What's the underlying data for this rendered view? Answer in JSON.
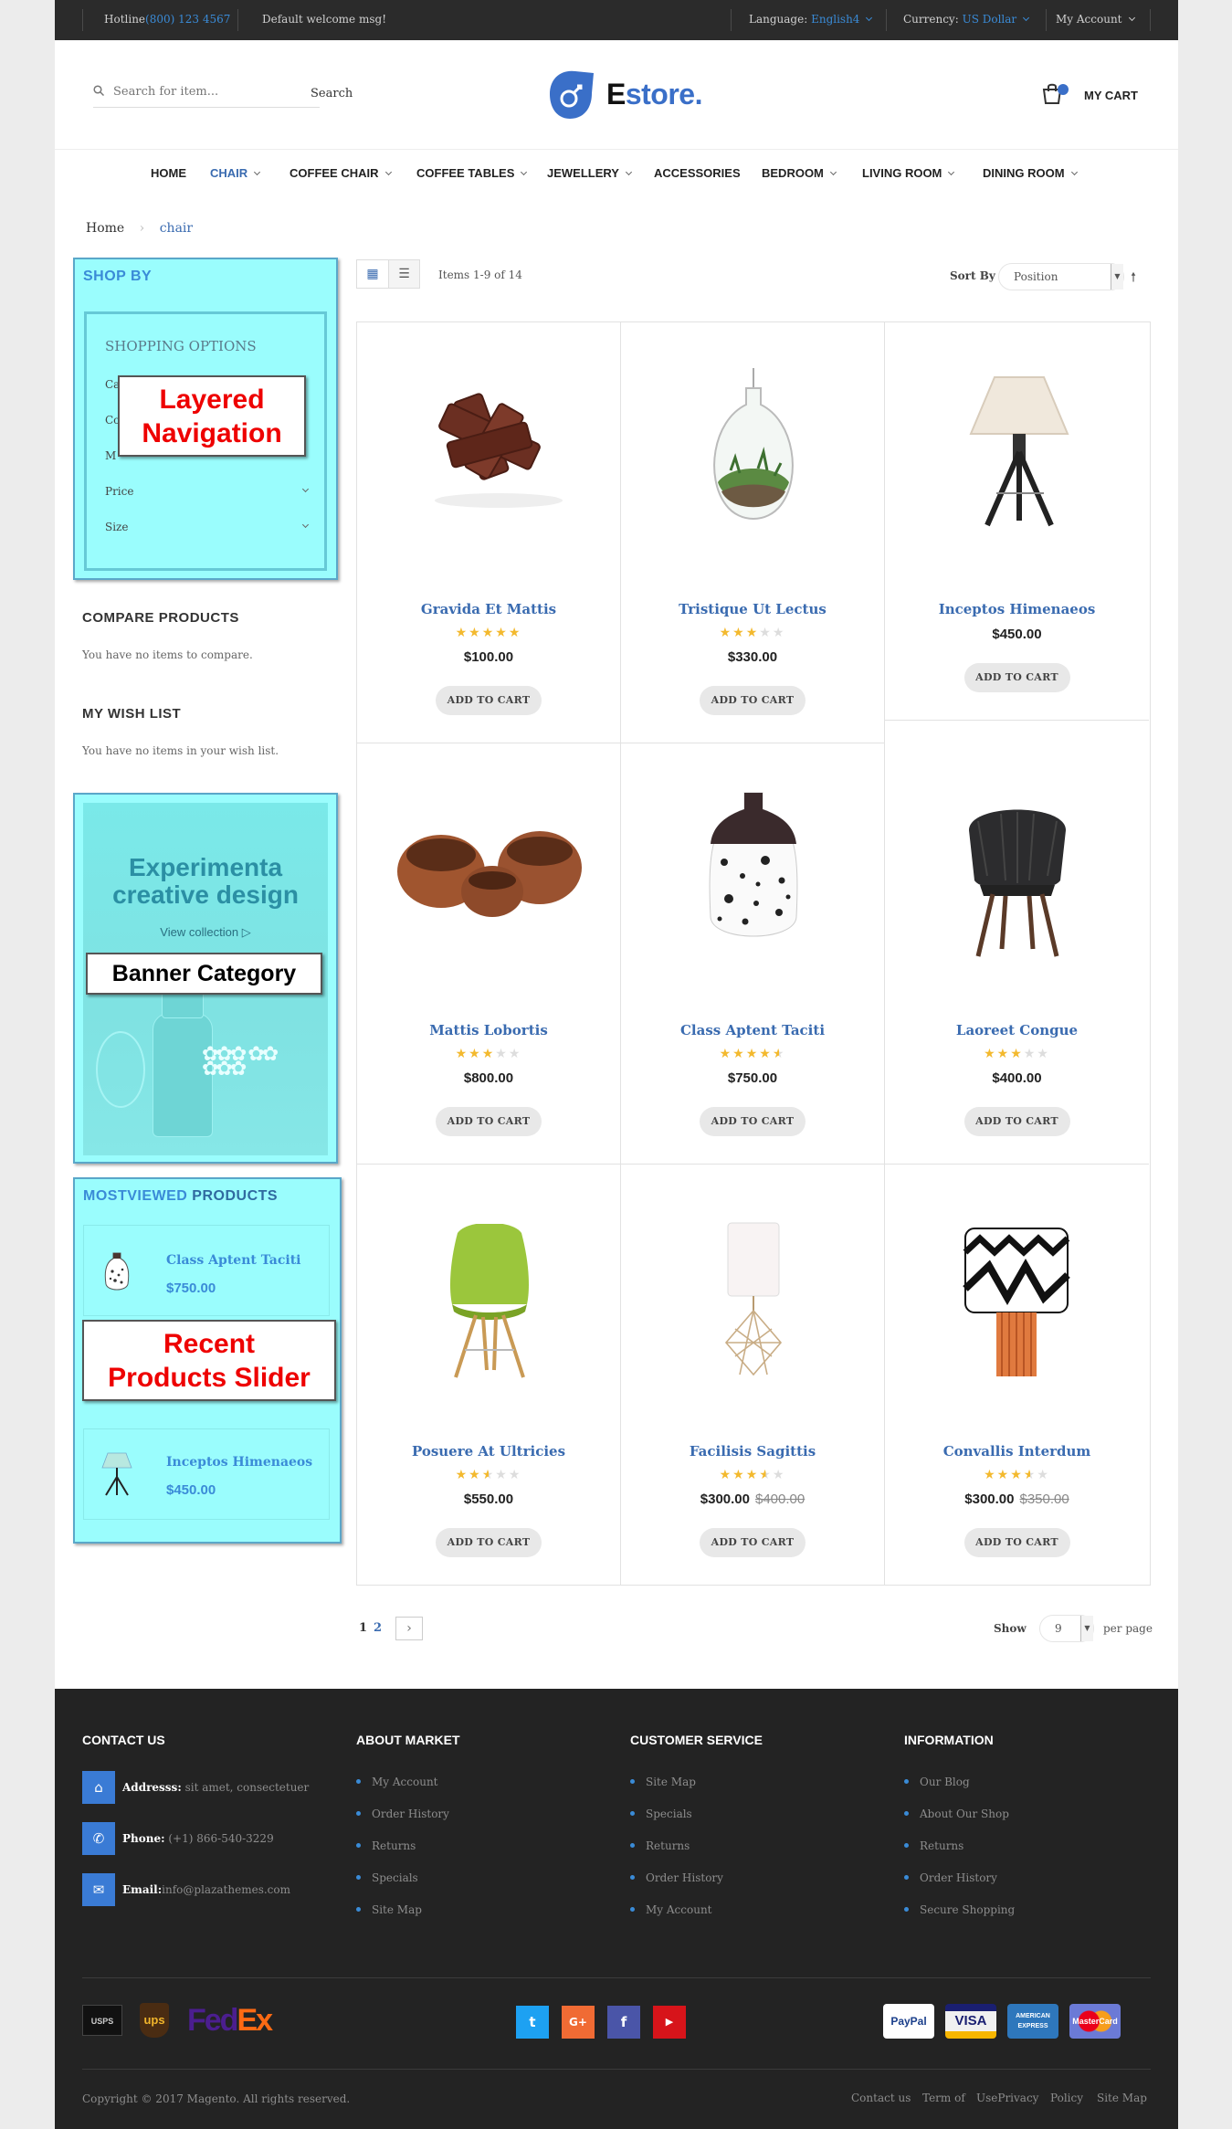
{
  "topbar": {
    "hotline_label": "Hotline",
    "hotline_number": "(800) 123 4567",
    "welcome": "Default welcome msg!",
    "language_label": "Language:",
    "language_value": "English4",
    "currency_label": "Currency:",
    "currency_value": "US Dollar",
    "account": "My Account"
  },
  "header": {
    "search_placeholder": "Search for item...",
    "search_button": "Search",
    "logo_first": "E",
    "logo_rest": "store.",
    "cart_label": "MY CART"
  },
  "nav": {
    "items": [
      {
        "label": "HOME"
      },
      {
        "label": "CHAIR"
      },
      {
        "label": "COFFEE CHAIR"
      },
      {
        "label": "COFFEE TABLES"
      },
      {
        "label": "JEWELLERY"
      },
      {
        "label": "ACCESSORIES"
      },
      {
        "label": "BEDROOM"
      },
      {
        "label": "LIVING ROOM"
      },
      {
        "label": "DINING ROOM"
      }
    ]
  },
  "breadcrumb": {
    "home": "Home",
    "current": "chair"
  },
  "sidebar": {
    "shop_by": "SHOP BY",
    "shopping_options": "SHOPPING OPTIONS",
    "filters": [
      "Ca",
      "Co",
      "M",
      "Price",
      "Size"
    ],
    "layered_callout_1": "Layered",
    "layered_callout_2": "Navigation",
    "compare_title": "COMPARE PRODUCTS",
    "compare_text": "You have no items to compare.",
    "wishlist_title": "MY WISH LIST",
    "wishlist_text": "You have no items in your wish list.",
    "banner_line1": "Experimenta",
    "banner_line2": "creative design",
    "banner_link": "View collection",
    "banner_callout": "Banner Category",
    "mostviewed_1": "MOSTVIEWED",
    "mostviewed_2": "PRODUCTS",
    "mv_products": [
      {
        "name": "Class Aptent Taciti",
        "price": "$750.00"
      },
      {
        "name": "Inceptos Himenaeos",
        "price": "$450.00"
      }
    ],
    "recent_callout_1": "Recent",
    "recent_callout_2": "Products Slider"
  },
  "toolbar": {
    "items_count": "Items 1-9 of 14",
    "sort_by": "Sort By",
    "sort_value": "Position",
    "show": "Show",
    "limit_value": "9",
    "per_page": "per page",
    "pages": [
      "1",
      "2"
    ]
  },
  "products": [
    {
      "name": "Gravida Et Mattis",
      "rating": 5,
      "price": "$100.00",
      "old_price": "",
      "add": "ADD TO CART"
    },
    {
      "name": "Tristique Ut Lectus",
      "rating": 3,
      "price": "$330.00",
      "old_price": "",
      "add": "ADD TO CART"
    },
    {
      "name": "Inceptos Himenaeos",
      "rating": 0,
      "price": "$450.00",
      "old_price": "",
      "add": "ADD TO CART"
    },
    {
      "name": "Mattis Lobortis",
      "rating": 3,
      "price": "$800.00",
      "old_price": "",
      "add": "ADD TO CART"
    },
    {
      "name": "Class Aptent Taciti",
      "rating": 4.5,
      "price": "$750.00",
      "old_price": "",
      "add": "ADD TO CART"
    },
    {
      "name": "Laoreet Congue",
      "rating": 3,
      "price": "$400.00",
      "old_price": "",
      "add": "ADD TO CART"
    },
    {
      "name": "Posuere At Ultricies",
      "rating": 2.5,
      "price": "$550.00",
      "old_price": "",
      "add": "ADD TO CART"
    },
    {
      "name": "Facilisis Sagittis",
      "rating": 3.5,
      "price": "$300.00",
      "old_price": "$400.00",
      "add": "ADD TO CART"
    },
    {
      "name": "Convallis Interdum",
      "rating": 3.5,
      "price": "$300.00",
      "old_price": "$350.00",
      "add": "ADD TO CART"
    }
  ],
  "footer": {
    "contact_title": "CONTACT US",
    "address_label": "Addresss:",
    "address_value": "sit amet, consectetuer",
    "phone_label": "Phone:",
    "phone_value": "(+1) 866-540-3229",
    "email_label": "Email:",
    "email_value": "info@plazathemes.com",
    "about_title": "ABOUT MARKET",
    "about_links": [
      "My Account",
      "Order History",
      "Returns",
      "Specials",
      "Site Map"
    ],
    "service_title": "CUSTOMER SERVICE",
    "service_links": [
      "Site Map",
      "Specials",
      "Returns",
      "Order History",
      "My Account"
    ],
    "info_title": "INFORMATION",
    "info_links": [
      "Our Blog",
      "About Our Shop",
      "Returns",
      "Order History",
      "Secure Shopping"
    ],
    "shipping_logos": [
      "USPS",
      "ups",
      "Fed",
      "Ex"
    ],
    "social": [
      "t",
      "G+",
      "f",
      "▶"
    ],
    "payments": [
      "PayPal",
      "VISA",
      "AMERICAN EXPRESS",
      "MasterCard"
    ],
    "copyright": "Copyright © 2017 Magento. All rights reserved.",
    "bottom_links": [
      "Contact us",
      "Term of",
      "UsePrivacy",
      "Policy",
      "Site Map"
    ]
  },
  "colors": {
    "accent": "#3a6bb0",
    "cyan_box": "#9afdfd",
    "footer_bg": "#232323",
    "star": "#f3b92e",
    "callout_red": "#ee0000"
  }
}
